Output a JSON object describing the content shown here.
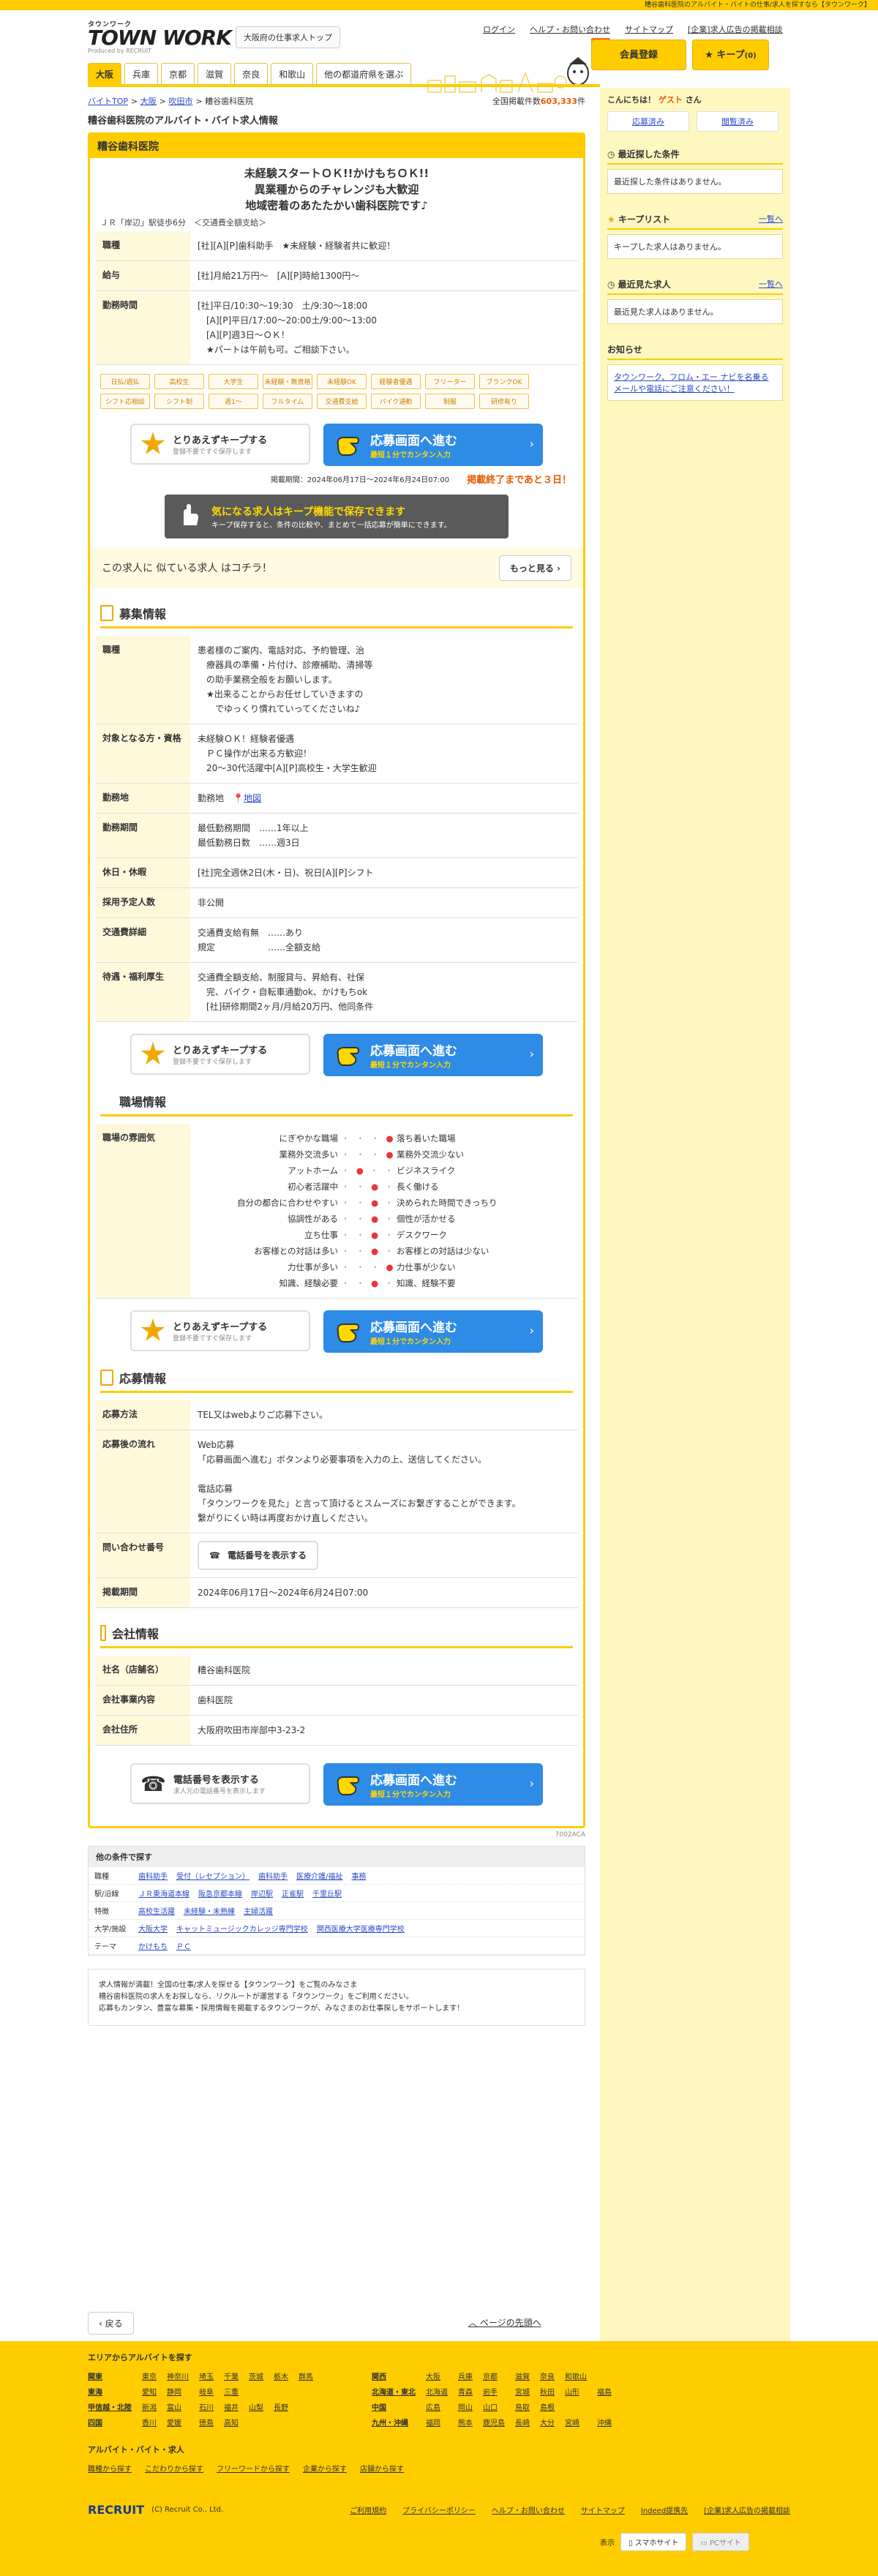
{
  "topbar": {
    "text": "糟谷歯科医院のアルバイト・バイトの仕事/求人を探すなら【タウンワーク】"
  },
  "header": {
    "logo_small": "タウンワーク",
    "logo_big": "TOWN WORK",
    "logo_by": "Produced by RECRUIT",
    "osaka_top": "大阪府の仕事求人トップ",
    "nav": [
      "ログイン",
      "ヘルプ・お問い合わせ",
      "サイトマップ",
      "[企業]求人広告の掲載相談"
    ],
    "member_tag": "無料",
    "member_btn": "会員登録",
    "keep_btn": "キープ",
    "keep_count": "(0)",
    "prefs": [
      "大阪",
      "兵庫",
      "京都",
      "滋賀",
      "奈良",
      "和歌山",
      "他の都道府県を選ぶ"
    ]
  },
  "crumbs": [
    "バイトTOP",
    "大阪",
    "吹田市",
    "糟谷歯科医院"
  ],
  "total": {
    "label": "全国掲載件数",
    "value": "603,333",
    "unit": "件"
  },
  "page_title": "糟谷歯科医院のアルバイト・バイト求人情報",
  "job": {
    "company": "糟谷歯科医院",
    "catch1": "未経験スタートＯＫ!!かけもちＯＫ!!",
    "catch2": "異業種からのチャレンジも大歓迎",
    "catch3": "地域密着のあたたかい歯科医院です♪",
    "access": "ＪＲ「岸辺」駅徒歩6分　＜交通費全額支給＞",
    "rows": [
      {
        "k": "職種",
        "v": "[社][A][P]歯科助手　★未経験・経験者共に歓迎！"
      },
      {
        "k": "給与",
        "v": "[社]月給21万円～　[A][P]時給1300円～"
      },
      {
        "k": "勤務時間",
        "v": "[社]平日/10:30～19:30　土/9:30～18:00\n　[A][P]平日/17:00～20:00土/9:00～13:00\n　[A][P]週3日～ＯＫ！\n　★パートは午前も可。ご相談下さい。"
      }
    ],
    "tags": [
      "日払/週払",
      "高校生",
      "大学生",
      "未経験・無資格",
      "未経験OK",
      "経験者優遇",
      "フリーター",
      "ブランクOK",
      "シフト応相談",
      "シフト制",
      "週1～",
      "フルタイム",
      "交通費支給",
      "バイク通勤",
      "制服",
      "研修有り"
    ],
    "keep_t1": "とりあえずキープする",
    "keep_t2": "登録不要ですぐ保存します",
    "apply_t1": "応募画面へ進む",
    "apply_t2": "最短１分でカンタン入力",
    "period": "掲載期間：2024年06月17日～2024年6月24日07:00",
    "remain": "掲載終了まであと３日！",
    "promo_t1": "気になる求人はキープ機能で保存できます",
    "promo_t2": "キープ保存すると、条件の比較や、まとめて一括応募が簡単にできます。",
    "similar": "この求人に 似ている求人 はコチラ！",
    "more": "もっと見る"
  },
  "recruit": {
    "title": "募集情報",
    "rows": [
      {
        "k": "職種",
        "v": "患者様のご案内、電話対応、予約管理、治\n　療器具の準備・片付け、診療補助、清掃等\n　の助手業務全般をお願いします。\n　★出来ることからお任せしていきますの\n　　でゆっくり慣れていってくださいね♪"
      },
      {
        "k": "対象となる方・資格",
        "v": "未経験ＯＫ！経験者優遇\n　ＰＣ操作が出来る方歓迎！\n　20～30代活躍中[A][P]高校生・大学生歓迎"
      },
      {
        "k": "勤務地",
        "v": "勤務地"
      },
      {
        "k": "勤務期間",
        "v": "最低勤務期間　……1年以上\n最低勤務日数　……週3日"
      },
      {
        "k": "休日・休暇",
        "v": "[社]完全週休2日(木・日)、祝日[A][P]シフト"
      },
      {
        "k": "採用予定人数",
        "v": "非公開"
      },
      {
        "k": "交通費詳細",
        "v": "交通費支給有無　……あり\n規定　　　　　　……全額支給"
      },
      {
        "k": "待遇・福利厚生",
        "v": "交通費全額支給、制服貸与、昇給有、社保\n　完、バイク・自転車通勤ok、かけもちok\n　[社]研修期間2ヶ月/月給20万円、他同条件"
      }
    ],
    "map": "地図"
  },
  "workplace": {
    "title": "職場情報",
    "label": "職場の雰囲気",
    "atmo": [
      {
        "l": "にぎやかな職場",
        "r": "落ち着いた職場",
        "pos": 2
      },
      {
        "l": "業務外交流多い",
        "r": "業務外交流少ない",
        "pos": 2
      },
      {
        "l": "アットホーム",
        "r": "ビジネスライク",
        "pos": 0
      },
      {
        "l": "初心者活躍中",
        "r": "長く働ける",
        "pos": 1
      },
      {
        "l": "自分の都合に合わせやすい",
        "r": "決められた時間できっちり",
        "pos": 1
      },
      {
        "l": "協調性がある",
        "r": "個性が活かせる",
        "pos": 1
      },
      {
        "l": "立ち仕事",
        "r": "デスクワーク",
        "pos": 1
      },
      {
        "l": "お客様との対話は多い",
        "r": "お客様との対話は少ない",
        "pos": 1
      },
      {
        "l": "力仕事が多い",
        "r": "力仕事が少ない",
        "pos": 2
      },
      {
        "l": "知識、経験必要",
        "r": "知識、経験不要",
        "pos": 1
      }
    ]
  },
  "apply": {
    "title": "応募情報",
    "rows": [
      {
        "k": "応募方法",
        "v": "TEL又はwebよりご応募下さい。"
      },
      {
        "k": "応募後の流れ",
        "v": "Web応募\n「応募画面へ進む」ボタンより必要事項を入力の上、送信してください。\n\n電話応募\n「タウンワークを見た」と言って頂けるとスムーズにお繋ぎすることができます。\n繋がりにくい時は再度おかけ直しください。"
      },
      {
        "k": "問い合わせ番号",
        "v": ""
      },
      {
        "k": "掲載期間",
        "v": "2024年06月17日～2024年6月24日07:00"
      }
    ],
    "tel_btn": "電話番号を表示する"
  },
  "company": {
    "title": "会社情報",
    "rows": [
      {
        "k": "社名（店舗名）",
        "v": "糟谷歯科医院"
      },
      {
        "k": "会社事業内容",
        "v": "歯科医院"
      },
      {
        "k": "会社住所",
        "v": "大阪府吹田市岸部中3-23-2"
      }
    ],
    "tel_t1": "電話番号を表示する",
    "tel_t2": "求人元の電話番号を表示します",
    "code": "7002ACA"
  },
  "other": {
    "title": "他の条件で探す",
    "rows": [
      {
        "k": "職種",
        "v": [
          "歯科助手",
          "受付（レセプション）",
          "歯科助手",
          "医療介護/福祉",
          "事務"
        ]
      },
      {
        "k": "駅/沿線",
        "v": [
          "ＪＲ東海道本線",
          "阪急京都本線",
          "岸辺駅",
          "正雀駅",
          "千里丘駅"
        ]
      },
      {
        "k": "特徴",
        "v": [
          "高校生活躍",
          "未経験・未熟練",
          "主婦活躍"
        ]
      },
      {
        "k": "大学/施設",
        "v": [
          "大阪大学",
          "キャットミュージックカレッジ専門学校",
          "関西医療大学医療専門学校"
        ]
      },
      {
        "k": "テーマ",
        "v": [
          "かけもち",
          "ＰＣ"
        ]
      }
    ]
  },
  "note": "求人情報が満載！全国の仕事/求人を探せる【タウンワーク】をご覧のみなさま\n糟谷歯科医院の求人をお探しなら、リクルートが運営する「タウンワーク」をご利用ください。\n応募もカンタン、豊富な募集・採用情報を掲載するタウンワークが、みなさまのお仕事探しをサポートします！",
  "side": {
    "greet": "こんにちは！",
    "guest": "ゲスト",
    "san": "さん",
    "btn1": "応募済み",
    "btn2": "閲覧済み",
    "s1": {
      "t": "最近探した条件",
      "c": "最近探した条件はありません。"
    },
    "s2": {
      "t": "キープリスト",
      "l": "一覧へ",
      "c": "キープした求人はありません。"
    },
    "s3": {
      "t": "最近見た求人",
      "l": "一覧へ",
      "c": "最近見た求人はありません。"
    },
    "s4": {
      "t": "お知らせ",
      "c": "タウンワーク、フロム・エー ナビを名乗るメールや電話にご注意ください！"
    }
  },
  "back": "戻る",
  "totop": "ページの先頭へ",
  "footer": {
    "h1": "エリアからアルバイトを探す",
    "areas1": [
      "関東",
      "東京",
      "神奈川",
      "埼玉",
      "千葉",
      "茨城",
      "栃木",
      "群馬",
      "東海",
      "愛知",
      "静岡",
      "岐阜",
      "三重",
      "",
      "",
      "",
      "甲信越・北陸",
      "新潟",
      "富山",
      "石川",
      "福井",
      "山梨",
      "長野",
      "",
      "四国",
      "香川",
      "愛媛",
      "徳島",
      "高知",
      "",
      "",
      ""
    ],
    "areas2": [
      "関西",
      "大阪",
      "兵庫",
      "京都",
      "滋賀",
      "奈良",
      "和歌山",
      "",
      "北海道・東北",
      "北海道",
      "青森",
      "岩手",
      "宮城",
      "秋田",
      "山形",
      "福島",
      "中国",
      "広島",
      "岡山",
      "山口",
      "鳥取",
      "島根",
      "",
      "",
      "九州・沖縄",
      "福岡",
      "熊本",
      "鹿児島",
      "長崎",
      "大分",
      "宮崎",
      "沖縄"
    ],
    "h2": "アルバイト・バイト・求人",
    "links": [
      "職種から探す",
      "こだわりから探す",
      "フリーワードから探す",
      "企業から探す",
      "店舗から探す"
    ],
    "copy": "(C) Recruit Co., Ltd.",
    "foot_links": [
      "ご利用規約",
      "プライバシーポリシー",
      "ヘルプ・お問い合わせ",
      "サイトマップ",
      "Indeed提携先",
      "[企業]求人広告の掲載相談"
    ],
    "display": "表示",
    "sp": "スマホサイト",
    "pc": "PCサイト"
  }
}
